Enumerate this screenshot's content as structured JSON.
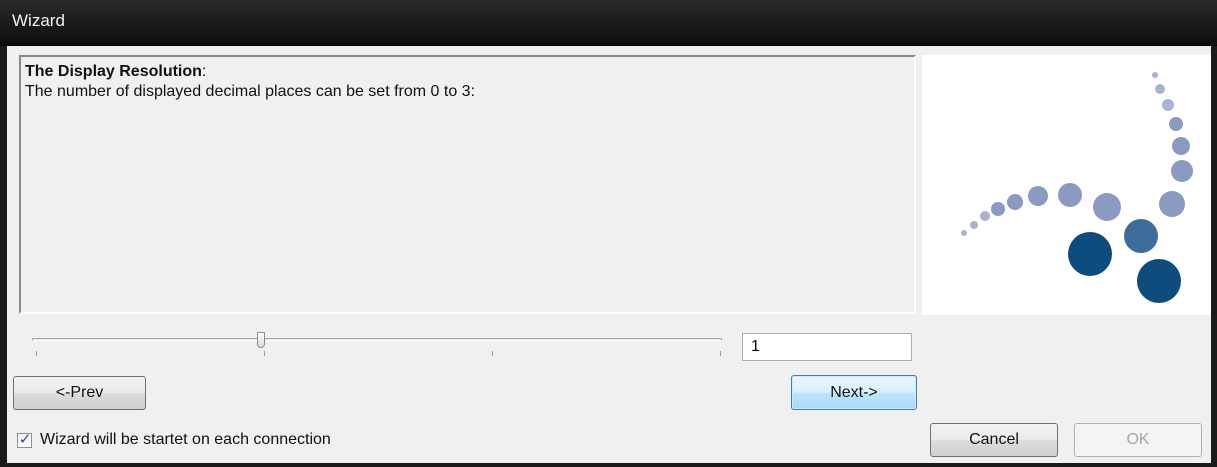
{
  "window": {
    "title": "Wizard"
  },
  "description": {
    "heading": "The Display Resolution",
    "heading_suffix": ":",
    "text": "The number of displayed decimal places can be set from 0 to 3:"
  },
  "slider": {
    "min": 0,
    "max": 3,
    "value": 1
  },
  "value_field": {
    "value": "1"
  },
  "buttons": {
    "prev": "<-Prev",
    "next": "Next->",
    "cancel": "Cancel",
    "ok": "OK"
  },
  "checkbox": {
    "label": "Wizard will be startet on each connection",
    "checked": true,
    "glyph": "✓"
  },
  "colors": {
    "logo_light": "#a9b3cf",
    "logo_mid": "#8a9ac0",
    "logo_blue": "#3d6d9a",
    "logo_dark": "#0f4c7e"
  }
}
